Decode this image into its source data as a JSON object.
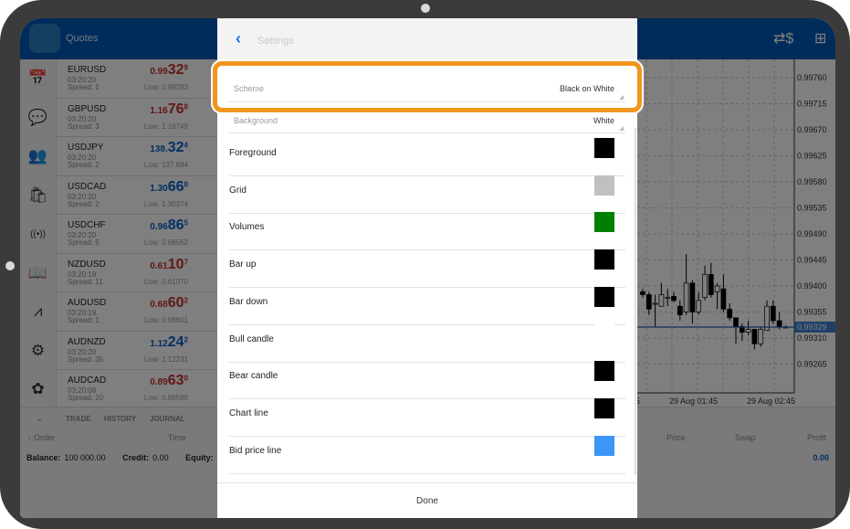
{
  "app": {
    "title": "Quotes",
    "header_icons": [
      "currency-exchange-icon",
      "new-order-icon"
    ]
  },
  "nav_icons": [
    "calendar-icon",
    "chat-icon",
    "community-icon",
    "market-icon",
    "signals-icon",
    "book-icon",
    "chart-icon",
    "settings-icon",
    "tradays-icon"
  ],
  "quotes": [
    {
      "symbol": "EURUSD",
      "time": "03:20:20",
      "spread": "Spread: 1",
      "p1": "0.99",
      "p2": "32",
      "p3": "9",
      "low": "Low: 0.99283",
      "dir": "red"
    },
    {
      "symbol": "GBPUSD",
      "time": "03:20:20",
      "spread": "Spread: 3",
      "p1": "1.16",
      "p2": "76",
      "p3": "8",
      "low": "Low: 1.16749",
      "dir": "red"
    },
    {
      "symbol": "USDJPY",
      "time": "03:20:20",
      "spread": "Spread: 2",
      "p1": "138.",
      "p2": "32",
      "p3": "4",
      "low": "Low: 137.684",
      "dir": "blue"
    },
    {
      "symbol": "USDCAD",
      "time": "03:20:20",
      "spread": "Spread: 2",
      "p1": "1.30",
      "p2": "66",
      "p3": "8",
      "low": "Low: 1.30374",
      "dir": "blue"
    },
    {
      "symbol": "USDCHF",
      "time": "03:20:20",
      "spread": "Spread: 5",
      "p1": "0.96",
      "p2": "86",
      "p3": "5",
      "low": "Low: 0.96562",
      "dir": "blue"
    },
    {
      "symbol": "NZDUSD",
      "time": "03:20:19",
      "spread": "Spread: 11",
      "p1": "0.61",
      "p2": "10",
      "p3": "7",
      "low": "Low: 0.61070",
      "dir": "red"
    },
    {
      "symbol": "AUDUSD",
      "time": "03:20:19",
      "spread": "Spread: 1",
      "p1": "0.68",
      "p2": "60",
      "p3": "2",
      "low": "Low: 0.68601",
      "dir": "red"
    },
    {
      "symbol": "AUDNZD",
      "time": "03:20:20",
      "spread": "Spread: 35",
      "p1": "1.12",
      "p2": "24",
      "p3": "2",
      "low": "Low: 1.12231",
      "dir": "blue"
    },
    {
      "symbol": "AUDCAD",
      "time": "03:20:08",
      "spread": "Spread: 20",
      "p1": "0.89",
      "p2": "63",
      "p3": "0",
      "low": "Low: 0.89590",
      "dir": "red"
    }
  ],
  "chart": {
    "price_labels": [
      "0.99760",
      "0.99715",
      "0.99670",
      "0.99625",
      "0.99580",
      "0.99535",
      "0.99490",
      "0.99445",
      "0.99400",
      "0.99355",
      "0.99310",
      "0.99265"
    ],
    "current_price": "0.99329",
    "time_labels": [
      "5",
      "29 Aug 01:45",
      "29 Aug 02:45"
    ],
    "candles": [
      [
        0.9939,
        0.99385,
        0.99395,
        0.9938
      ],
      [
        0.99385,
        0.9936,
        0.9939,
        0.9935
      ],
      [
        0.9937,
        0.9937,
        0.99385,
        0.9933
      ],
      [
        0.99365,
        0.99385,
        0.99405,
        0.99365
      ],
      [
        0.9938,
        0.9938,
        0.99395,
        0.99365
      ],
      [
        0.99382,
        0.99375,
        0.9939,
        0.99372
      ],
      [
        0.99365,
        0.9935,
        0.99375,
        0.9934
      ],
      [
        0.99355,
        0.99405,
        0.99455,
        0.9935
      ],
      [
        0.99405,
        0.99355,
        0.9941,
        0.99335
      ],
      [
        0.99355,
        0.99375,
        0.9939,
        0.9935
      ],
      [
        0.9938,
        0.9942,
        0.99435,
        0.99375
      ],
      [
        0.9942,
        0.99385,
        0.9944,
        0.9938
      ],
      [
        0.9939,
        0.994,
        0.99405,
        0.9936
      ],
      [
        0.99395,
        0.9936,
        0.9942,
        0.99355
      ],
      [
        0.9936,
        0.99345,
        0.9937,
        0.9934
      ],
      [
        0.99345,
        0.9933,
        0.99345,
        0.993
      ],
      [
        0.9933,
        0.9932,
        0.99335,
        0.99305
      ],
      [
        0.9932,
        0.99325,
        0.9934,
        0.99315
      ],
      [
        0.99325,
        0.993,
        0.99325,
        0.9929
      ],
      [
        0.993,
        0.99325,
        0.9933,
        0.99295
      ],
      [
        0.99323,
        0.99365,
        0.99375,
        0.99323
      ],
      [
        0.99365,
        0.9934,
        0.99375,
        0.99335
      ],
      [
        0.9934,
        0.9933,
        0.99355,
        0.99325
      ],
      [
        0.99329,
        0.99329,
        0.99332,
        0.99328
      ]
    ]
  },
  "bottom": {
    "tabs": [
      "TRADE",
      "HISTORY",
      "JOURNAL"
    ],
    "columns": [
      "Order",
      "Time",
      "Price",
      "Swap",
      "Profit"
    ],
    "balance_label": "Balance:",
    "balance": "100 000.00",
    "credit_label": "Credit:",
    "credit": "0.00",
    "equity_label": "Equity:",
    "profit": "0.00"
  },
  "settings": {
    "title": "Settings",
    "scheme": {
      "label": "Scheme",
      "value": "Black on White"
    },
    "background": {
      "label": "Background",
      "value": "White"
    },
    "items": [
      {
        "label": "Foreground",
        "color": "#000000"
      },
      {
        "label": "Grid",
        "color": "#c0c0c0"
      },
      {
        "label": "Volumes",
        "color": "#008000"
      },
      {
        "label": "Bar up",
        "color": "#000000"
      },
      {
        "label": "Bar down",
        "color": "#000000"
      },
      {
        "label": "Bull candle",
        "color": "#ffffff"
      },
      {
        "label": "Bear candle",
        "color": "#000000"
      },
      {
        "label": "Chart line",
        "color": "#000000"
      },
      {
        "label": "Bid price line",
        "color": "#3d95f5"
      }
    ],
    "done_label": "Done"
  },
  "colors": {
    "highlight": "#f0961e",
    "header": "#0058b8"
  }
}
